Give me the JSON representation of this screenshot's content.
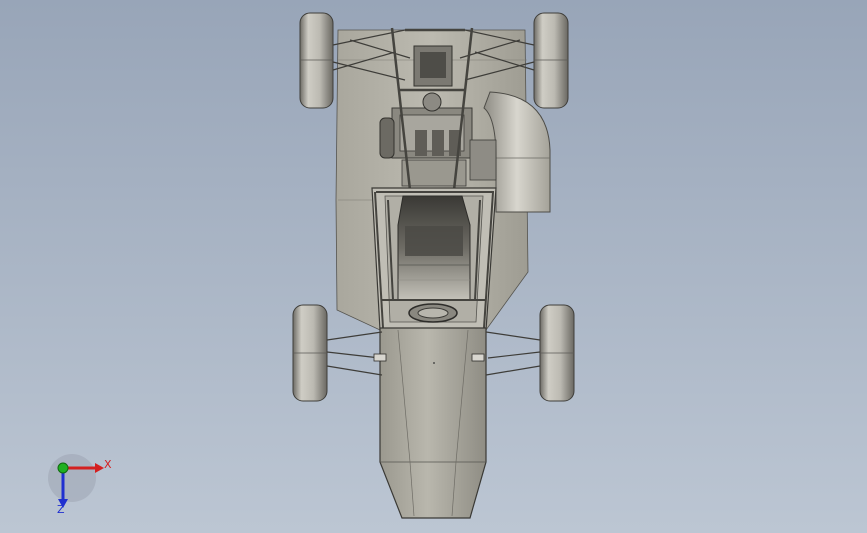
{
  "colors": {
    "background_top": "#9aa6b8",
    "background_bottom": "#b9c4d2",
    "body_panel": "#b3b1a6",
    "body_panel_shade": "#8d8b81",
    "tire_light": "#c9c7bf",
    "tire_dark": "#6f6d66",
    "frame_tube": "#4a4944",
    "seat_dark": "#3b3a36",
    "axis_x": "#d42020",
    "axis_y": "#20b020",
    "axis_z": "#2030d0"
  },
  "triad": {
    "x_label": "X",
    "z_label": "Z",
    "icon": "coordinate-triad-icon"
  }
}
